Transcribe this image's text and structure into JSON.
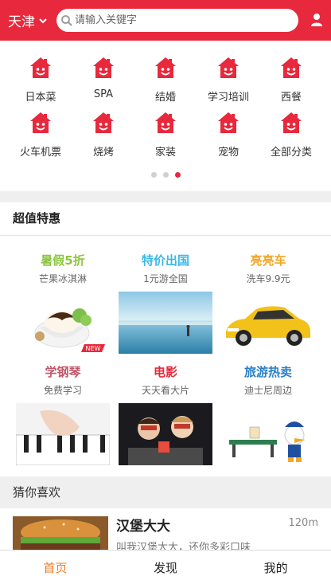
{
  "header": {
    "city": "天津",
    "search_placeholder": "请输入关键字",
    "accent_color": "#e8283c"
  },
  "categories": [
    {
      "label": "日本菜",
      "icon": "house-icon"
    },
    {
      "label": "SPA",
      "icon": "house-icon"
    },
    {
      "label": "结婚",
      "icon": "house-icon"
    },
    {
      "label": "学习培训",
      "icon": "house-icon"
    },
    {
      "label": "西餐",
      "icon": "house-icon"
    },
    {
      "label": "火车机票",
      "icon": "house-icon"
    },
    {
      "label": "烧烤",
      "icon": "house-icon"
    },
    {
      "label": "家装",
      "icon": "house-icon"
    },
    {
      "label": "宠物",
      "icon": "house-icon"
    },
    {
      "label": "全部分类",
      "icon": "house-icon"
    }
  ],
  "pager": {
    "count": 3,
    "active_index": 2
  },
  "deals": {
    "title": "超值特惠",
    "items": [
      {
        "title": "暑假5折",
        "subtitle": "芒果冰淇淋",
        "color": "#8cc63f",
        "badge": "NEW"
      },
      {
        "title": "特价出国",
        "subtitle": "1元游全国",
        "color": "#3bb8e8"
      },
      {
        "title": "亮亮车",
        "subtitle": "洗车9.9元",
        "color": "#f5a623"
      },
      {
        "title": "学钢琴",
        "subtitle": "免费学习",
        "color": "#c0566a"
      },
      {
        "title": "电影",
        "subtitle": "天天看大片",
        "color": "#e8283c"
      },
      {
        "title": "旅游热卖",
        "subtitle": "迪士尼周边",
        "color": "#2a7fc9"
      }
    ]
  },
  "guess": {
    "title": "猜你喜欢",
    "items": [
      {
        "name": "汉堡大大",
        "distance": "120m",
        "description": "叫我汉堡大大，还你多彩口味"
      }
    ]
  },
  "tabbar": {
    "items": [
      "首页",
      "发现",
      "我的"
    ],
    "active_index": 0,
    "active_color": "#f07a22"
  }
}
